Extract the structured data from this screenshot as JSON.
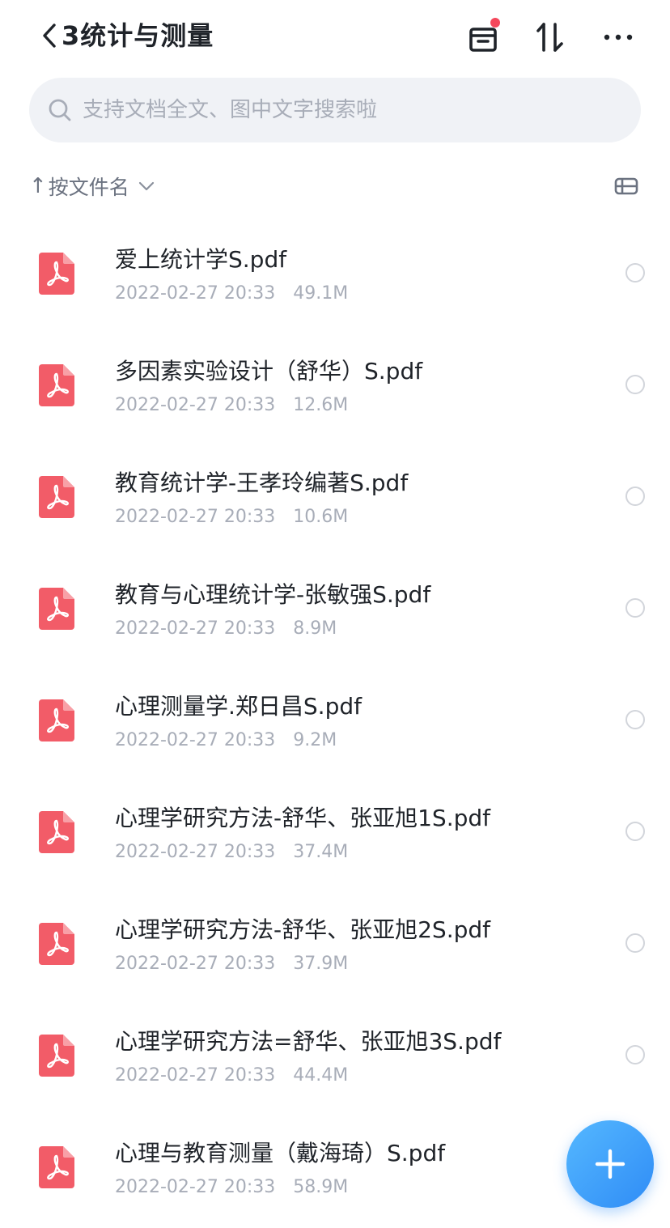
{
  "header": {
    "title": "3统计与测量",
    "dot_color": "#f5475b"
  },
  "search": {
    "placeholder": "支持文档全文、图中文字搜索啦"
  },
  "sort": {
    "arrow": "↑",
    "label": "按文件名"
  },
  "files": [
    {
      "name": "爱上统计学S.pdf",
      "date": "2022-02-27 20:33",
      "size": "49.1M"
    },
    {
      "name": "多因素实验设计（舒华）S.pdf",
      "date": "2022-02-27 20:33",
      "size": "12.6M"
    },
    {
      "name": "教育统计学-王孝玲编著S.pdf",
      "date": "2022-02-27 20:33",
      "size": "10.6M"
    },
    {
      "name": "教育与心理统计学-张敏强S.pdf",
      "date": "2022-02-27 20:33",
      "size": "8.9M"
    },
    {
      "name": "心理测量学.郑日昌S.pdf",
      "date": "2022-02-27 20:33",
      "size": "9.2M"
    },
    {
      "name": "心理学研究方法-舒华、张亚旭1S.pdf",
      "date": "2022-02-27 20:33",
      "size": "37.4M"
    },
    {
      "name": "心理学研究方法-舒华、张亚旭2S.pdf",
      "date": "2022-02-27 20:33",
      "size": "37.9M"
    },
    {
      "name": "心理学研究方法=舒华、张亚旭3S.pdf",
      "date": "2022-02-27 20:33",
      "size": "44.4M"
    },
    {
      "name": "心理与教育测量（戴海琦）S.pdf",
      "date": "2022-02-27 20:33",
      "size": "58.9M"
    }
  ],
  "colors": {
    "pdf_icon": "#f25c68",
    "accent": "#2f8cf6",
    "meta_text": "#a8adb8"
  },
  "icons": {
    "back": "chevron-left-icon",
    "archive": "archive-box-icon",
    "sort_toggle": "sort-arrows-icon",
    "more": "more-dots-icon",
    "search": "search-icon",
    "view": "list-view-icon",
    "file": "pdf-file-icon",
    "fab": "plus-icon"
  }
}
